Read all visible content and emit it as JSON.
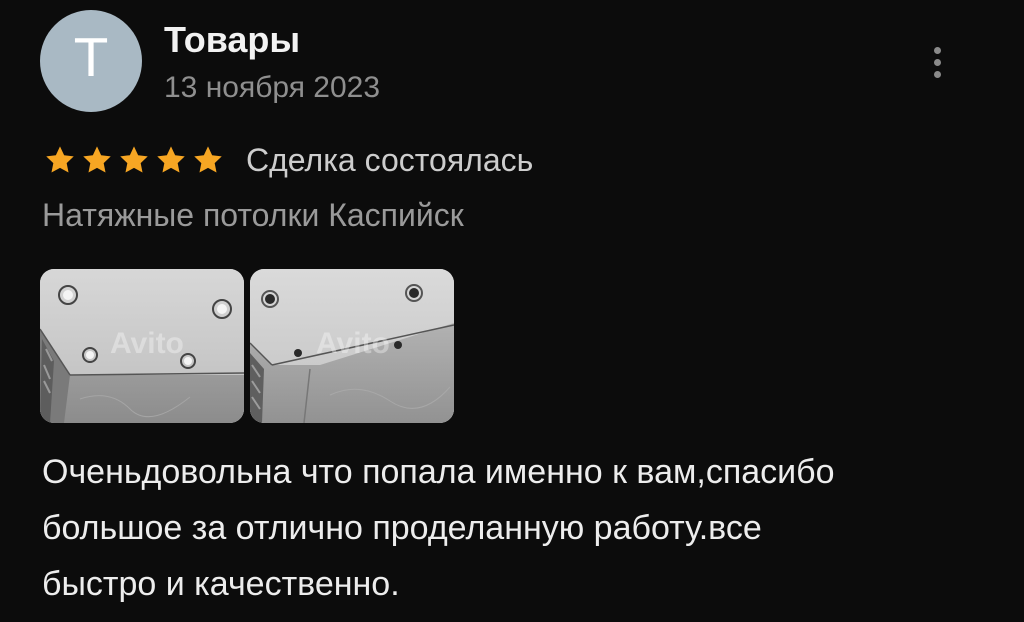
{
  "review": {
    "avatar_letter": "T",
    "author_name": "Товары",
    "date": "13 ноября 2023",
    "rating": 5,
    "rating_max": 5,
    "deal_status": "Сделка состоялась",
    "item_title": "Натяжные потолки Каспийск",
    "photos": [
      {
        "watermark": "Avito"
      },
      {
        "watermark": "Avito"
      }
    ],
    "text": "Оченьдовольна что попала именно к вам,спасибо\nбольшое за отлично проделанную  работу.все\nбыстро и качественно."
  },
  "colors": {
    "background": "#0c0c0c",
    "avatar": "#a9b9c4",
    "star": "#f7a623",
    "muted_text": "#9a9a9a"
  },
  "icons": {
    "more": "more-vertical-icon",
    "star": "star-icon"
  }
}
